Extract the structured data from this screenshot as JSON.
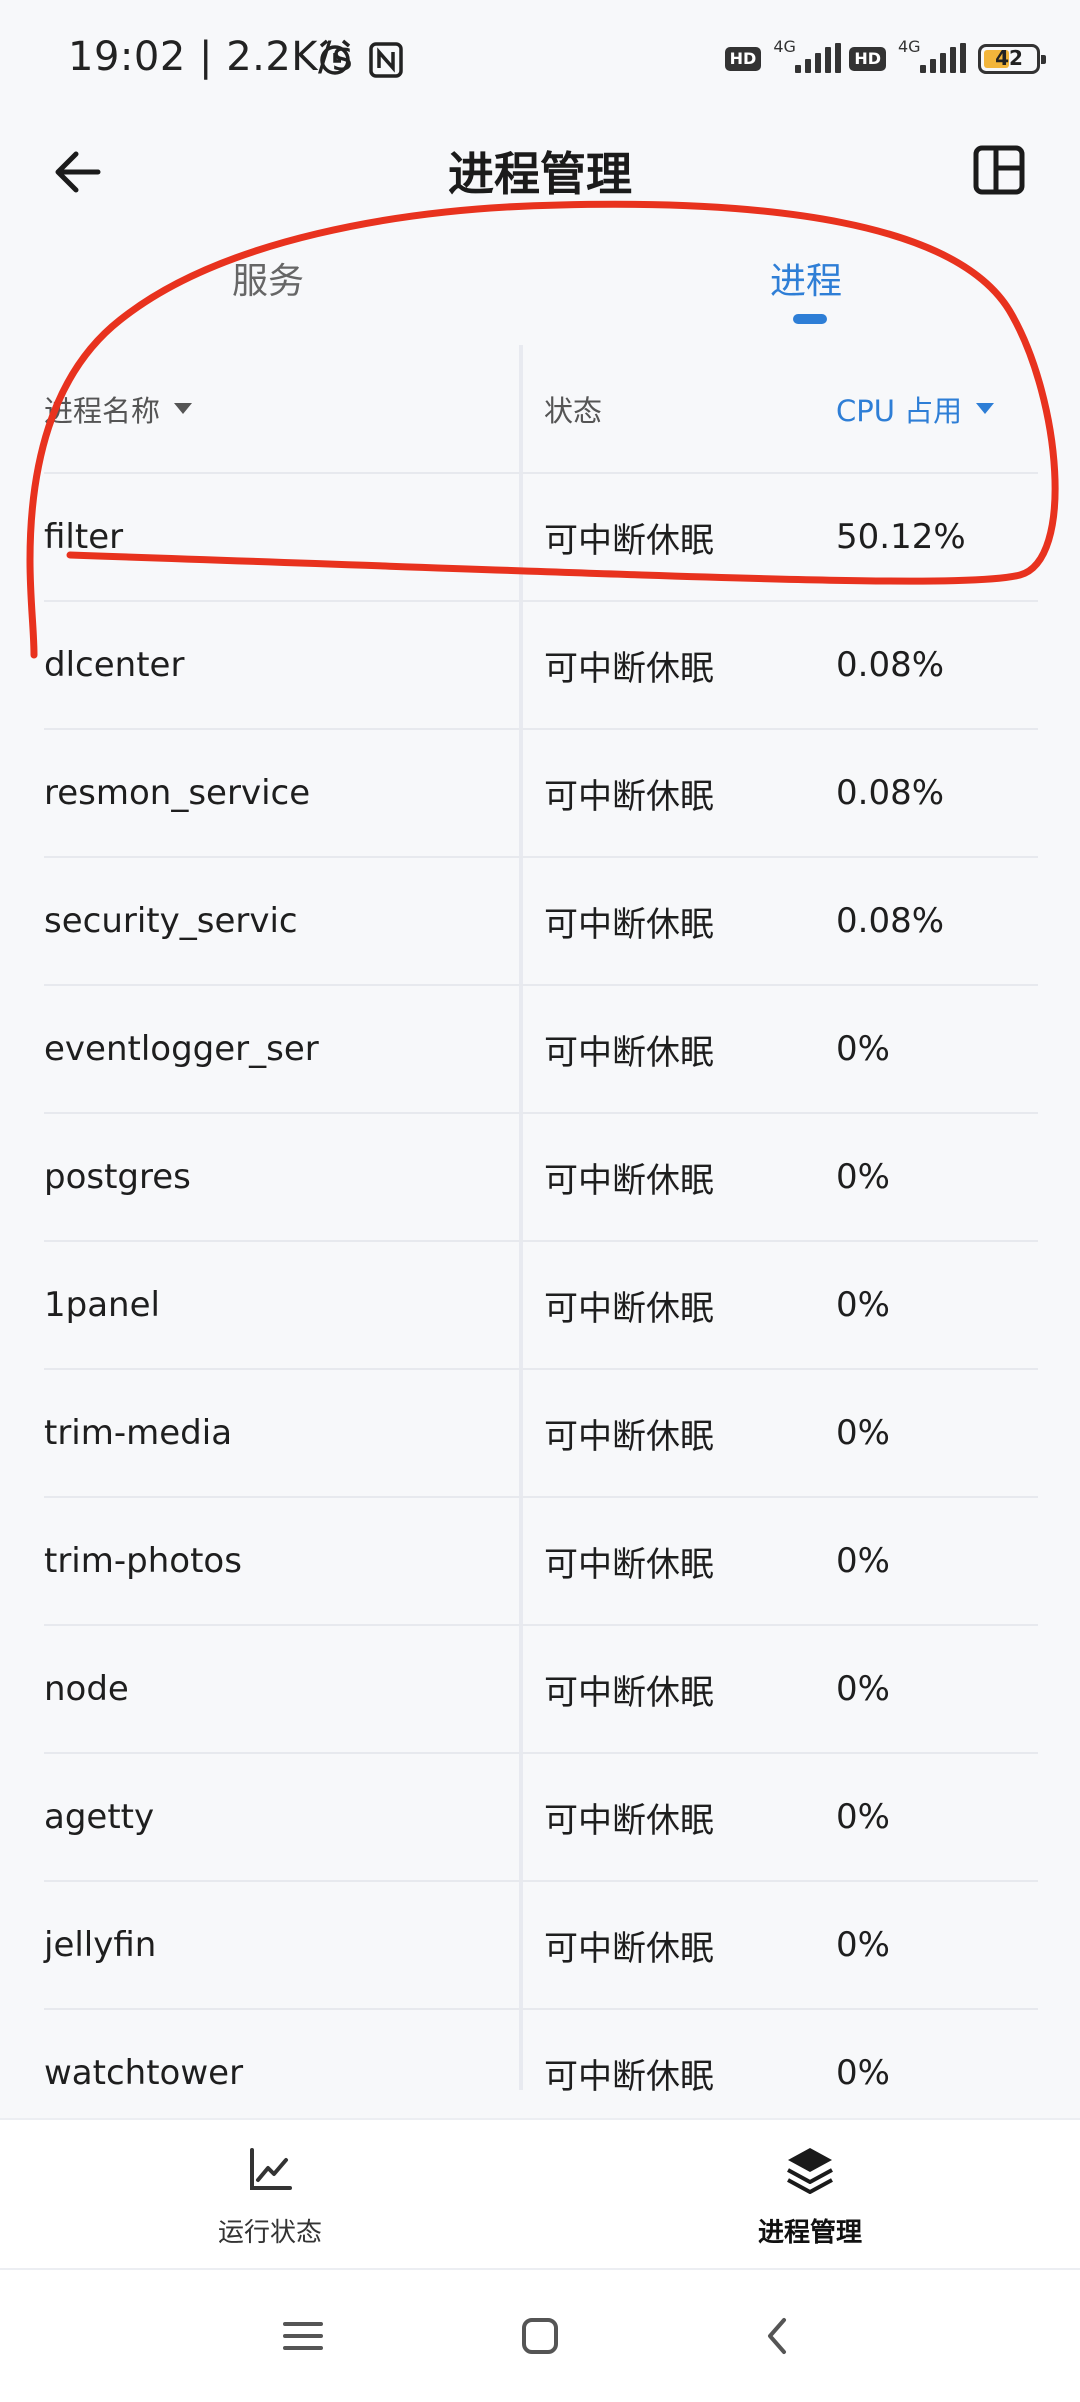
{
  "status_bar": {
    "time": "19:02",
    "net_speed": "2.2K/s",
    "sim1_type": "HD",
    "sim1_net": "4G",
    "sim2_type": "HD",
    "sim2_net": "4G",
    "battery": "42",
    "icons": [
      "alarm-icon",
      "nfc-icon",
      "signal-icon",
      "battery-icon"
    ]
  },
  "header": {
    "title": "进程管理",
    "back_icon": "arrow-left-icon",
    "layout_icon": "layout-icon"
  },
  "tabs": [
    {
      "label": "服务",
      "active": false
    },
    {
      "label": "进程",
      "active": true
    }
  ],
  "table": {
    "headers": {
      "name": "进程名称",
      "state": "状态",
      "cpu": "CPU 占用"
    },
    "rows": [
      {
        "name": "filter",
        "state": "可中断休眠",
        "cpu": "50.12%"
      },
      {
        "name": "dlcenter",
        "state": "可中断休眠",
        "cpu": "0.08%"
      },
      {
        "name": "resmon_service",
        "state": "可中断休眠",
        "cpu": "0.08%"
      },
      {
        "name": "security_servic",
        "state": "可中断休眠",
        "cpu": "0.08%"
      },
      {
        "name": "eventlogger_ser",
        "state": "可中断休眠",
        "cpu": "0%"
      },
      {
        "name": "postgres",
        "state": "可中断休眠",
        "cpu": "0%"
      },
      {
        "name": "1panel",
        "state": "可中断休眠",
        "cpu": "0%"
      },
      {
        "name": "trim-media",
        "state": "可中断休眠",
        "cpu": "0%"
      },
      {
        "name": "trim-photos",
        "state": "可中断休眠",
        "cpu": "0%"
      },
      {
        "name": "node",
        "state": "可中断休眠",
        "cpu": "0%"
      },
      {
        "name": "agetty",
        "state": "可中断休眠",
        "cpu": "0%"
      },
      {
        "name": "jellyfin",
        "state": "可中断休眠",
        "cpu": "0%"
      },
      {
        "name": "watchtower",
        "state": "可中断休眠",
        "cpu": "0%"
      }
    ]
  },
  "bottom_nav": {
    "items": [
      {
        "label": "运行状态",
        "icon": "chart-line-icon",
        "active": false
      },
      {
        "label": "进程管理",
        "icon": "layers-icon",
        "active": true
      }
    ]
  },
  "colors": {
    "accent": "#2e7ed6",
    "annotation": "#e8321e",
    "background": "#f7f8fa"
  }
}
